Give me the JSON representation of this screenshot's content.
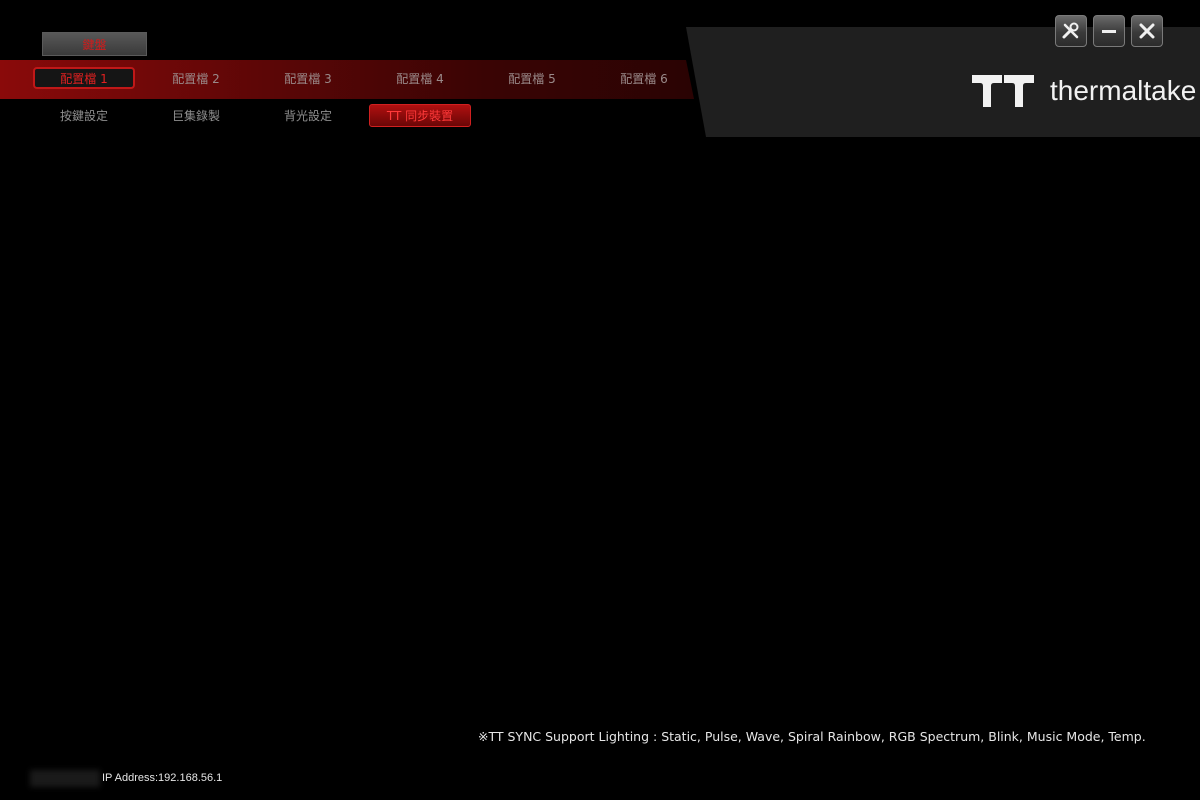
{
  "device_tab": "鍵盤",
  "profiles": [
    {
      "label": "配置檔 1",
      "active": true
    },
    {
      "label": "配置檔 2",
      "active": false
    },
    {
      "label": "配置檔 3",
      "active": false
    },
    {
      "label": "配置檔 4",
      "active": false
    },
    {
      "label": "配置檔 5",
      "active": false
    },
    {
      "label": "配置檔 6",
      "active": false
    }
  ],
  "sub_tabs": [
    {
      "label": "按鍵設定",
      "active": false
    },
    {
      "label": "巨集錄製",
      "active": false
    },
    {
      "label": "背光設定",
      "active": false
    },
    {
      "label": "TT 同步裝置",
      "active": true
    }
  ],
  "brand": {
    "name": "thermaltake"
  },
  "window_buttons": [
    "settings-icon",
    "minimize-icon",
    "close-icon"
  ],
  "footer": {
    "note": "※TT SYNC Support Lighting : Static, Pulse, Wave, Spiral Rainbow, RGB Spectrum, Blink, Music Mode, Temp.",
    "ip": "IP Address:192.168.56.1"
  },
  "colors": {
    "accent": "#d21b1b",
    "background": "#000000"
  }
}
